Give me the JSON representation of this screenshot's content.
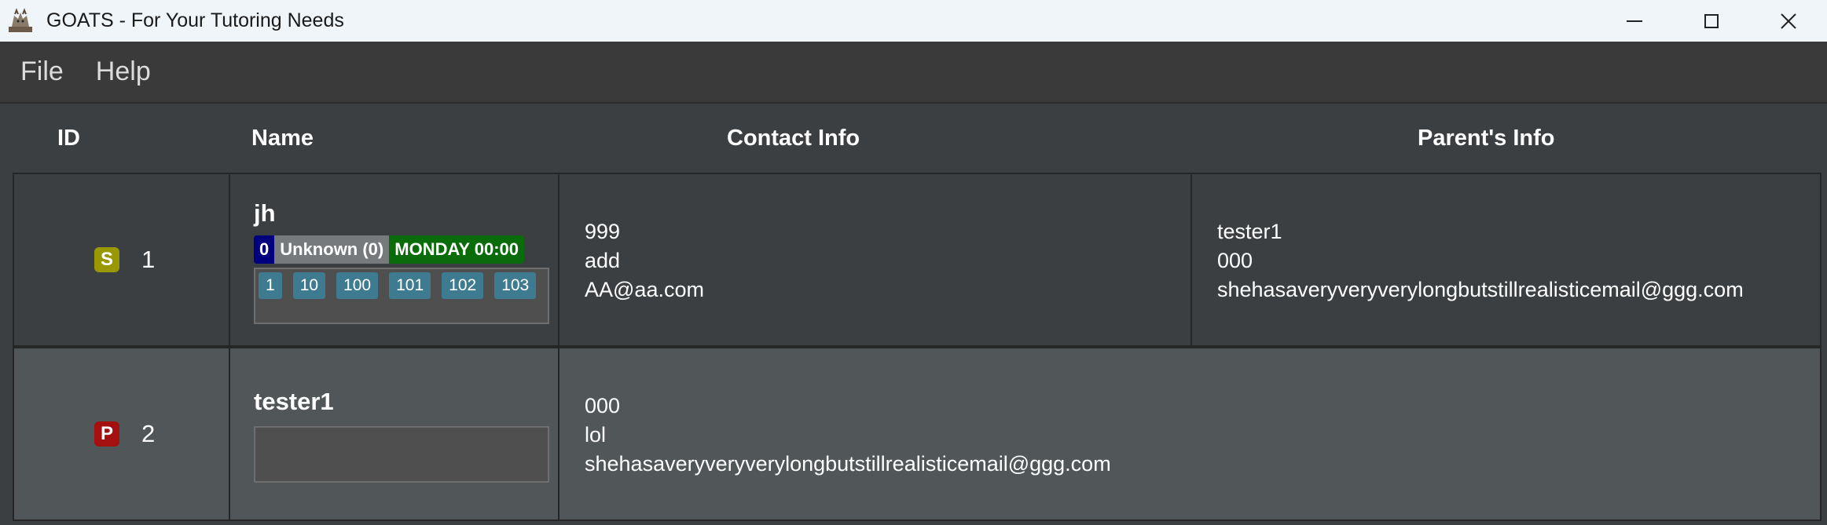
{
  "window": {
    "title": "GOATS - For Your Tutoring Needs",
    "icon": "goat-icon",
    "controls": [
      "minimize-icon",
      "maximize-icon",
      "close-icon"
    ]
  },
  "menu": {
    "items": [
      "File",
      "Help"
    ]
  },
  "table": {
    "headers": {
      "id": "ID",
      "name": "Name",
      "contact": "Contact Info",
      "parent": "Parent's Info"
    },
    "rows": [
      {
        "role": "S",
        "id": "1",
        "name": "jh",
        "flags": {
          "count": "0",
          "status": "Unknown (0)",
          "schedule": "MONDAY 00:00"
        },
        "tags": [
          "1",
          "10",
          "100",
          "101",
          "102",
          "103"
        ],
        "contact": [
          "999",
          "add",
          "AA@aa.com"
        ],
        "parent": [
          "tester1",
          "000",
          "shehasaveryveryverylongbutstillrealisticemail@ggg.com"
        ]
      },
      {
        "role": "P",
        "id": "2",
        "name": "tester1",
        "tags": [],
        "contact": [
          "000",
          "lol",
          "shehasaveryveryverylongbutstillrealisticemail@ggg.com"
        ]
      }
    ]
  },
  "colors": {
    "student_badge": "#9a9800",
    "parent_badge": "#a40f0f",
    "tag": "#3e7b91",
    "schedule": "#0a6b0a",
    "count": "#00007f"
  }
}
